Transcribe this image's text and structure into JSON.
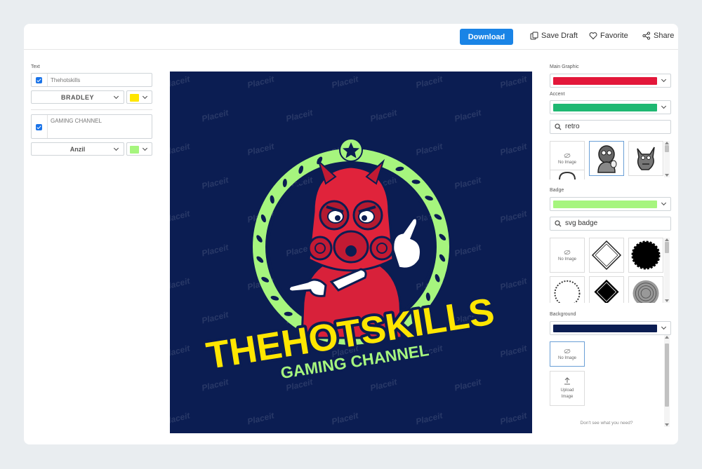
{
  "toolbar": {
    "download_label": "Download",
    "save_draft_label": "Save Draft",
    "favorite_label": "Favorite",
    "share_label": "Share"
  },
  "left_panel": {
    "section_label": "Text",
    "fields": [
      {
        "value": "Thehotskills",
        "checked": true,
        "font": "BRADLEY",
        "color": "#ffe600"
      },
      {
        "value": "GAMING CHANNEL",
        "checked": true,
        "font": "Anzil",
        "color": "#a6f57e"
      }
    ]
  },
  "canvas": {
    "background_color": "#0b1d52",
    "watermark_text": "Placeit",
    "logo_title": "THEHOTSKILLS",
    "logo_subtitle": "GAMING CHANNEL",
    "title_color": "#ffe600",
    "subtitle_color": "#a6f57e",
    "wreath_color": "#a6f57e",
    "mascot_color": "#e0233b"
  },
  "right_panel": {
    "main_graphic": {
      "label": "Main Graphic",
      "color": "#e3173a"
    },
    "accent": {
      "label": "Accent",
      "color": "#1fb872",
      "search_value": "retro",
      "no_image_label": "No Image"
    },
    "badge": {
      "label": "Badge",
      "color": "#a6f57e",
      "search_value": "svg badge",
      "no_image_label": "No Image"
    },
    "background": {
      "label": "Background",
      "color": "#0b1d52",
      "no_image_label": "No Image",
      "upload_label": "Upload Image"
    },
    "hint": "Don't see what you need?"
  },
  "icons": [
    "save-draft-icon",
    "heart-icon",
    "share-icon",
    "search-icon",
    "no-image-icon",
    "upload-icon",
    "chevron-down-icon"
  ]
}
